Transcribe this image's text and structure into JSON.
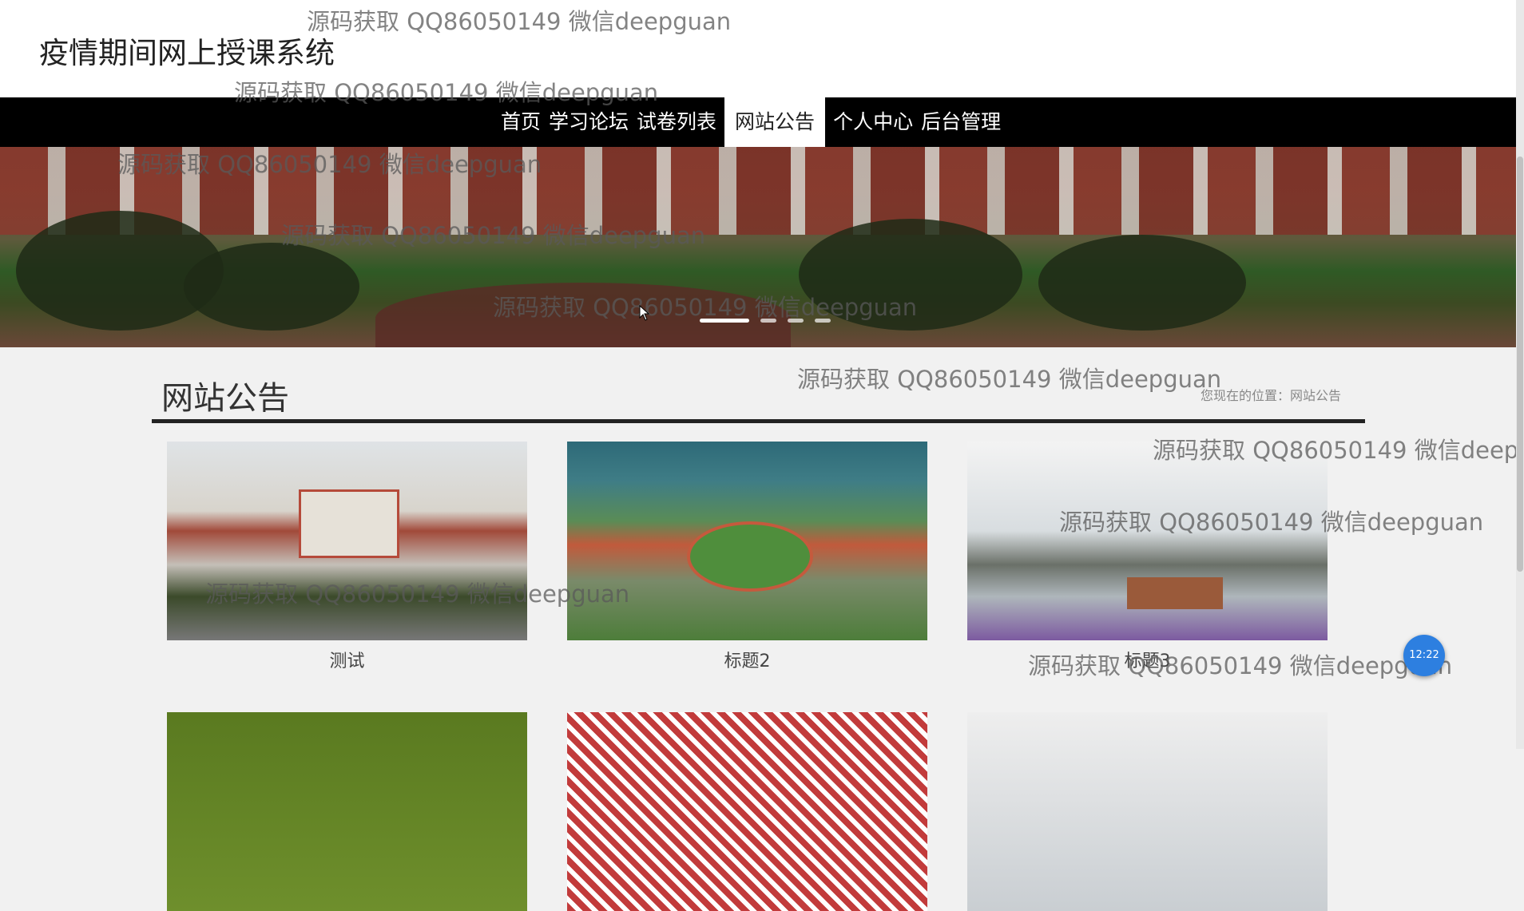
{
  "site": {
    "title": "疫情期间网上授课系统"
  },
  "nav": {
    "items": [
      {
        "label": "首页",
        "active": false
      },
      {
        "label": "学习论坛",
        "active": false
      },
      {
        "label": "试卷列表",
        "active": false
      },
      {
        "label": "网站公告",
        "active": true
      },
      {
        "label": "个人中心",
        "active": false
      },
      {
        "label": "后台管理",
        "active": false
      }
    ]
  },
  "banner": {
    "slide_count": 4,
    "active_slide": 1
  },
  "section": {
    "title": "网站公告",
    "breadcrumb": "您现在的位置：网站公告"
  },
  "cards": [
    {
      "caption": "测试"
    },
    {
      "caption": "标题2"
    },
    {
      "caption": "标题3"
    },
    {
      "caption": ""
    },
    {
      "caption": ""
    },
    {
      "caption": ""
    }
  ],
  "watermark": "源码获取 QQ86050149 微信deepguan",
  "clock": {
    "time": "12:22"
  }
}
